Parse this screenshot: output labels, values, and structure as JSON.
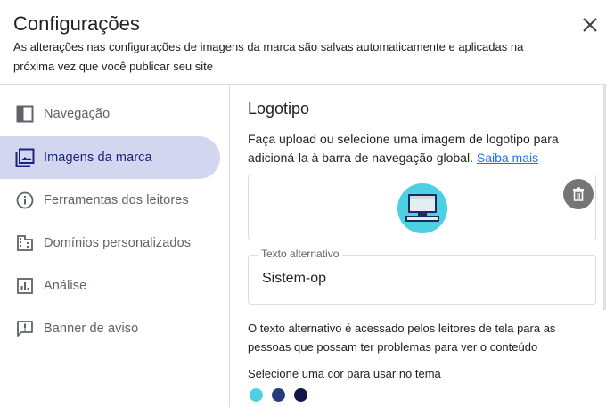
{
  "header": {
    "title": "Configurações",
    "subtitle": "As alterações nas configurações de imagens da marca são salvas automaticamente e aplicadas na próxima vez que você publicar seu site",
    "close_icon": "close-icon"
  },
  "sidebar": {
    "items": [
      {
        "label": "Navegação",
        "icon": "navigation-icon",
        "active": false
      },
      {
        "label": "Imagens da marca",
        "icon": "image-icon",
        "active": true
      },
      {
        "label": "Ferramentas dos leitores",
        "icon": "info-icon",
        "active": false
      },
      {
        "label": "Domínios personalizados",
        "icon": "domain-icon",
        "active": false
      },
      {
        "label": "Análise",
        "icon": "analytics-icon",
        "active": false
      },
      {
        "label": "Banner de aviso",
        "icon": "announcement-icon",
        "active": false
      }
    ]
  },
  "main": {
    "section_title": "Logotipo",
    "description": "Faça upload ou selecione uma imagem de logotipo para adicioná-la à barra de navegação global.",
    "learn_more": "Saiba mais",
    "alt_text_label": "Texto alternativo",
    "alt_text_value": "Sistem-op",
    "alt_help": "O texto alternativo é acessado pelos leitores de tela para as pessoas que possam ter problemas para ver o conteúdo",
    "color_label": "Selecione uma cor para usar no tema",
    "colors": [
      "#4dd0e1",
      "#283b7a",
      "#141447"
    ]
  },
  "colors": {
    "active_nav_bg": "#d2d7ef",
    "active_nav_text": "#1a237e",
    "link": "#1a73e8"
  }
}
